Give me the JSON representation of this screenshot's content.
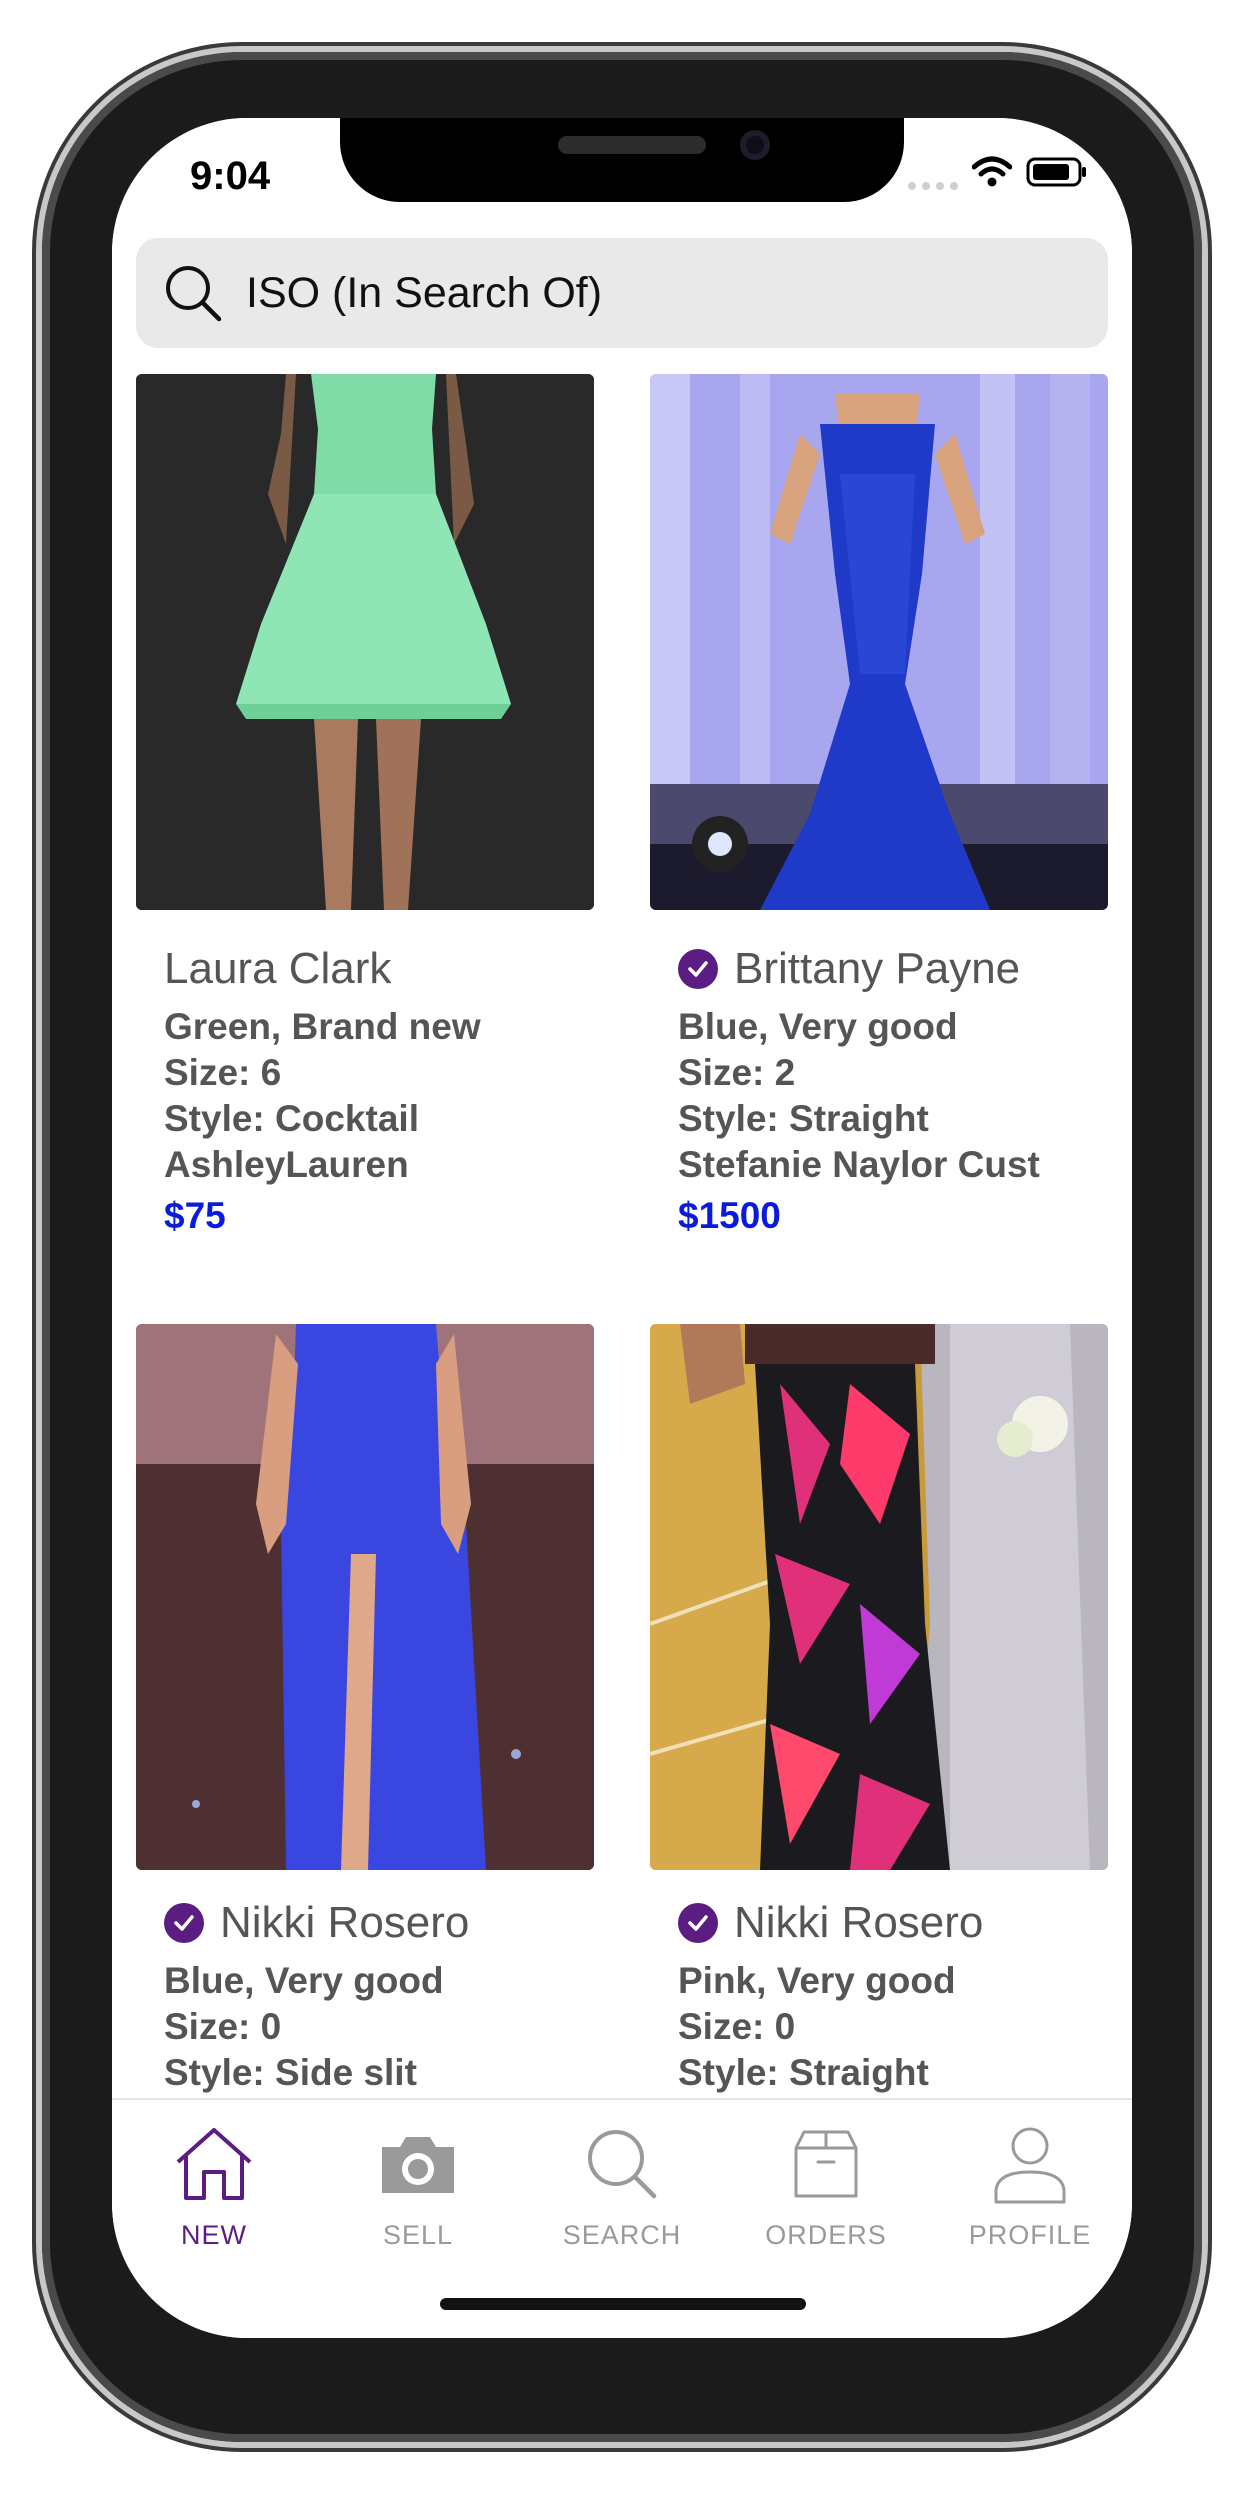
{
  "status": {
    "time": "9:04"
  },
  "search": {
    "label": "ISO (In Search Of)"
  },
  "listings": [
    {
      "seller": "Laura Clark",
      "verified": false,
      "condition": "Green, Brand new",
      "size": "Size: 6",
      "style": "Style: Cocktail",
      "designer": "AshleyLauren",
      "price": "$75",
      "dress_color": "#8fe6b4"
    },
    {
      "seller": "Brittany Payne",
      "verified": true,
      "condition": "Blue, Very good",
      "size": "Size: 2",
      "style": "Style: Straight",
      "designer": "Stefanie Naylor Cust",
      "price": "$1500",
      "dress_color": "#1f3ac9"
    },
    {
      "seller": "Nikki Rosero",
      "verified": true,
      "condition": "Blue, Very good",
      "size": "Size: 0",
      "style": "Style: Side slit",
      "dress_color": "#3a46e0"
    },
    {
      "seller": "Nikki Rosero",
      "verified": true,
      "condition": "Pink, Very good",
      "size": "Size: 0",
      "style": "Style: Straight",
      "dress_color": "#e0307a"
    }
  ],
  "tabs": [
    {
      "label": "NEW",
      "icon": "home-icon",
      "active": true
    },
    {
      "label": "SELL",
      "icon": "camera-icon",
      "active": false
    },
    {
      "label": "SEARCH",
      "icon": "search-icon",
      "active": false
    },
    {
      "label": "ORDERS",
      "icon": "box-icon",
      "active": false
    },
    {
      "label": "PROFILE",
      "icon": "person-icon",
      "active": false
    }
  ],
  "colors": {
    "accent": "#5b1d82",
    "price": "#0b1bdc"
  }
}
